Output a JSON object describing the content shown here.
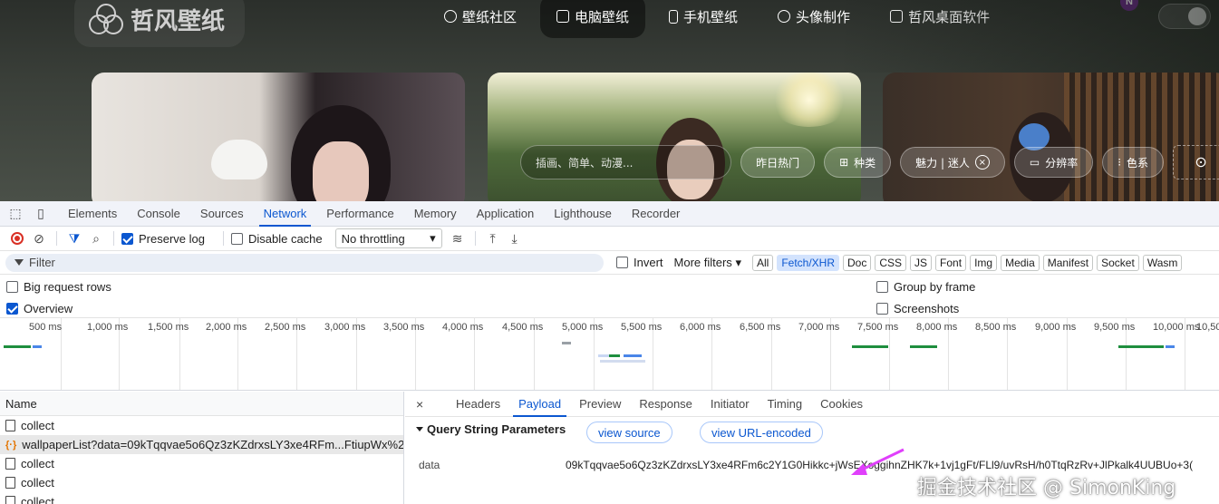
{
  "site": {
    "logo_text": "哲风壁纸",
    "nav": [
      {
        "label": "壁纸社区",
        "icon": "chat-icon"
      },
      {
        "label": "电脑壁纸",
        "icon": "image-icon"
      },
      {
        "label": "手机壁纸",
        "icon": "phone-icon"
      },
      {
        "label": "头像制作",
        "icon": "smile-icon"
      },
      {
        "label": "哲风桌面软件",
        "icon": "monitor-icon"
      }
    ],
    "badge": "N",
    "search_placeholder": "插画、简单、动漫...",
    "chips": [
      "昨日热门",
      "种类",
      "魅力 | 迷人",
      "分辨率",
      "色系"
    ],
    "chip_close": "×"
  },
  "devtools": {
    "tabs": [
      "Elements",
      "Console",
      "Sources",
      "Network",
      "Performance",
      "Memory",
      "Application",
      "Lighthouse",
      "Recorder"
    ],
    "active_tab": "Network",
    "toolbar": {
      "preserve_log": "Preserve log",
      "disable_cache": "Disable cache",
      "throttling": "No throttling"
    },
    "filter": {
      "placeholder": "Filter",
      "invert": "Invert",
      "more_filters": "More filters",
      "types": [
        "All",
        "Fetch/XHR",
        "Doc",
        "CSS",
        "JS",
        "Font",
        "Img",
        "Media",
        "Manifest",
        "Socket",
        "Wasm"
      ],
      "selected_type": "Fetch/XHR"
    },
    "options": {
      "big_request_rows": "Big request rows",
      "overview": "Overview",
      "group_by_frame": "Group by frame",
      "screenshots": "Screenshots"
    },
    "timeline_ticks": [
      "500 ms",
      "1,000 ms",
      "1,500 ms",
      "2,000 ms",
      "2,500 ms",
      "3,000 ms",
      "3,500 ms",
      "4,000 ms",
      "4,500 ms",
      "5,000 ms",
      "5,500 ms",
      "6,000 ms",
      "6,500 ms",
      "7,000 ms",
      "7,500 ms",
      "8,000 ms",
      "8,500 ms",
      "9,000 ms",
      "9,500 ms",
      "10,000 ms",
      "10,50"
    ],
    "requests": {
      "header": "Name",
      "rows": [
        {
          "name": "collect",
          "type": "doc",
          "selected": false
        },
        {
          "name": "wallpaperList?data=09kTqqvae5o6Qz3zKZdrxsLY3xe4RFm...FtiupWx%2...",
          "type": "xhr",
          "selected": true
        },
        {
          "name": "collect",
          "type": "doc",
          "selected": false
        },
        {
          "name": "collect",
          "type": "doc",
          "selected": false
        },
        {
          "name": "collect",
          "type": "doc",
          "selected": false
        }
      ]
    },
    "detail": {
      "close": "×",
      "tabs": [
        "Headers",
        "Payload",
        "Preview",
        "Response",
        "Initiator",
        "Timing",
        "Cookies"
      ],
      "active_tab": "Payload",
      "section_title": "Query String Parameters",
      "view_source": "view source",
      "view_url_encoded": "view URL-encoded",
      "param_key": "data",
      "param_value": "09kTqqvae5o6Qz3zKZdrxsLY3xe4RFm6c2Y1G0Hikkc+jWsEXoggihnZHK7k+1vj1gFt/FLl9/uvRsH/h0TtqRzRv+JlPkalk4UUBUo+3("
    },
    "watermark": "掘金技术社区 @ SimonKing"
  },
  "colors": {
    "accent": "#0b57d0",
    "record": "#d93025",
    "arrow": "#e040fb"
  }
}
